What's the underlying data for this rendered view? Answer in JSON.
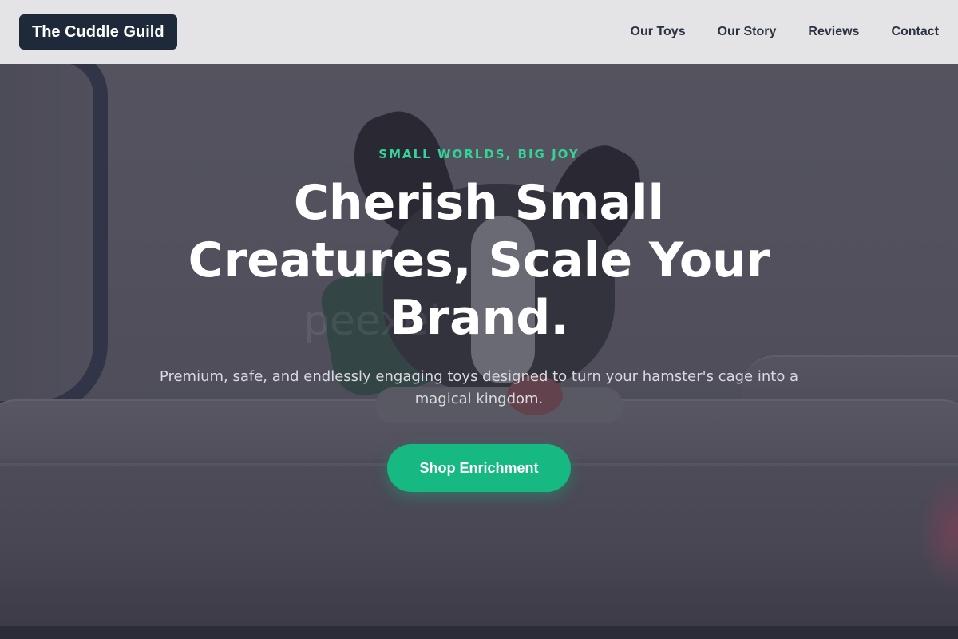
{
  "header": {
    "logo": "The Cuddle Guild",
    "nav": [
      {
        "label": "Our Toys"
      },
      {
        "label": "Our Story"
      },
      {
        "label": "Reviews"
      },
      {
        "label": "Contact"
      }
    ]
  },
  "hero": {
    "eyebrow": "SMALL WORLDS, BIG JOY",
    "headline": "Cherish Small Creatures, Scale Your Brand.",
    "subtitle": "Premium, safe, and endlessly engaging toys designed to turn your hamster's cage into a magical kingdom.",
    "cta_label": "Shop Enrichment",
    "background_image": "dog-on-sofa-photo",
    "watermark": "peexel"
  },
  "colors": {
    "accent": "#16b981",
    "eyebrow": "#34d399",
    "logo_bg": "#1e2a3a",
    "header_bg": "#e4e4e7"
  }
}
